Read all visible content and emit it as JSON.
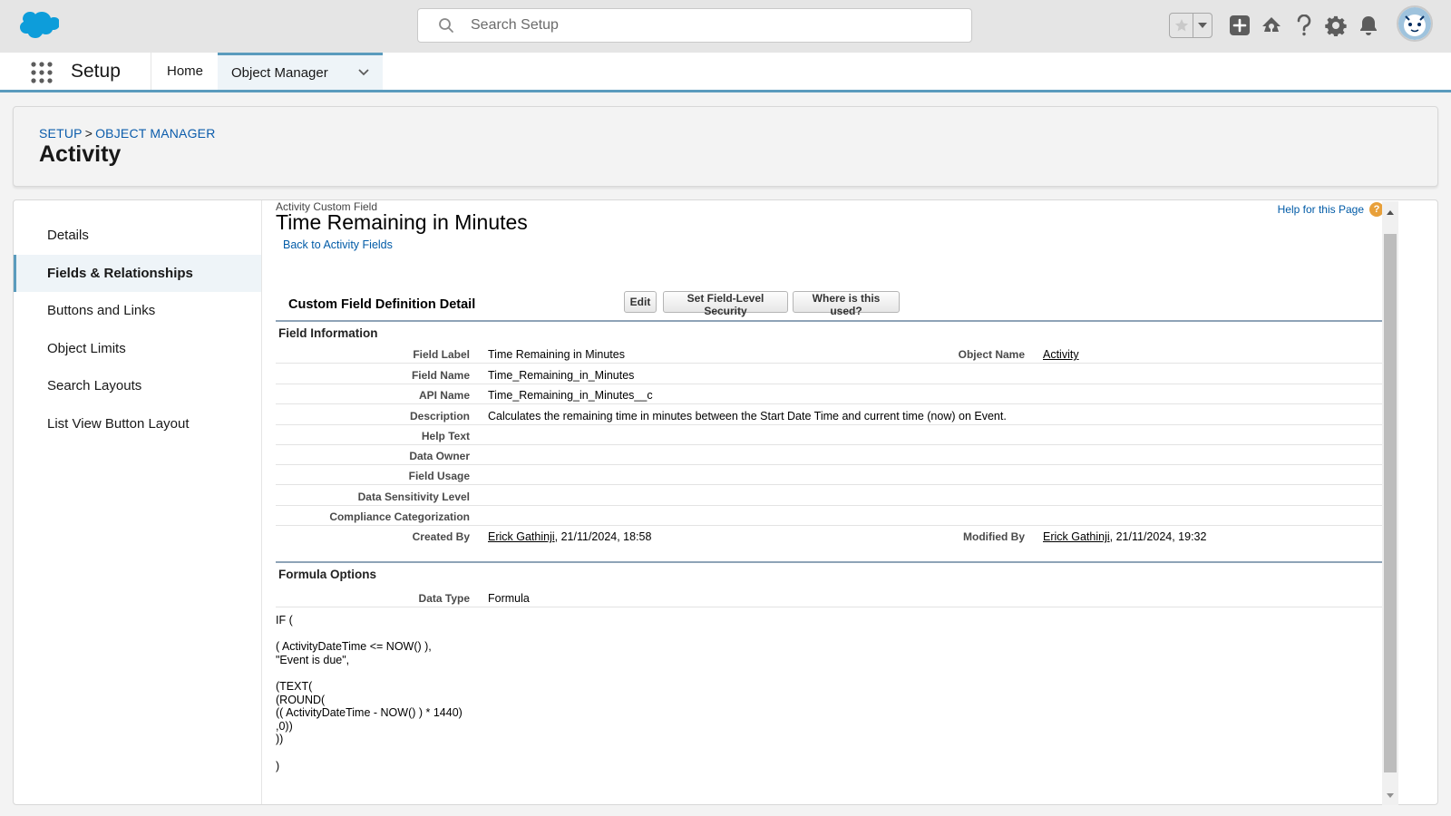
{
  "header": {
    "search_placeholder": "Search Setup"
  },
  "nav": {
    "app_name": "Setup",
    "tabs": [
      {
        "label": "Home"
      },
      {
        "label": "Object Manager"
      }
    ]
  },
  "page_header": {
    "breadcrumb": [
      "SETUP",
      "OBJECT MANAGER"
    ],
    "breadcrumb_sep": ">",
    "title": "Activity"
  },
  "sidebar": {
    "items": [
      {
        "label": "Details"
      },
      {
        "label": "Fields & Relationships"
      },
      {
        "label": "Buttons and Links"
      },
      {
        "label": "Object Limits"
      },
      {
        "label": "Search Layouts"
      },
      {
        "label": "List View Button Layout"
      }
    ]
  },
  "detail": {
    "eyebrow": "Activity Custom Field",
    "title": "Time Remaining in Minutes",
    "back_link": "Back to Activity Fields",
    "help_link": "Help for this Page",
    "section_title": "Custom Field Definition Detail",
    "buttons": {
      "edit": "Edit",
      "fls": "Set Field-Level Security",
      "where": "Where is this used?"
    },
    "field_info": {
      "title": "Field Information",
      "rows": [
        {
          "label": "Field Label",
          "value": "Time Remaining in Minutes"
        },
        {
          "label": "Field Name",
          "value": "Time_Remaining_in_Minutes"
        },
        {
          "label": "API Name",
          "value": "Time_Remaining_in_Minutes__c"
        },
        {
          "label": "Description",
          "value": "Calculates the remaining time in minutes between the Start Date Time and current time (now) on Event."
        },
        {
          "label": "Help Text",
          "value": ""
        },
        {
          "label": "Data Owner",
          "value": ""
        },
        {
          "label": "Field Usage",
          "value": ""
        },
        {
          "label": "Data Sensitivity Level",
          "value": ""
        },
        {
          "label": "Compliance Categorization",
          "value": ""
        },
        {
          "label": "Created By",
          "value": ""
        }
      ],
      "object_name_label": "Object Name",
      "object_name_value": "Activity",
      "created_by_user": "Erick Gathinji",
      "created_by_date": ", 21/11/2024, 18:58",
      "modified_by_label": "Modified By",
      "modified_by_user": "Erick Gathinji",
      "modified_by_date": ", 21/11/2024, 19:32"
    },
    "formula_options": {
      "title": "Formula Options",
      "data_type_label": "Data Type",
      "data_type_value": "Formula",
      "formula_text": "IF (\n\n( ActivityDateTime <= NOW() ),\n\"Event is due\",\n\n(TEXT(\n(ROUND(\n(( ActivityDateTime - NOW() ) * 1440)\n,0))\n))\n\n)"
    }
  }
}
